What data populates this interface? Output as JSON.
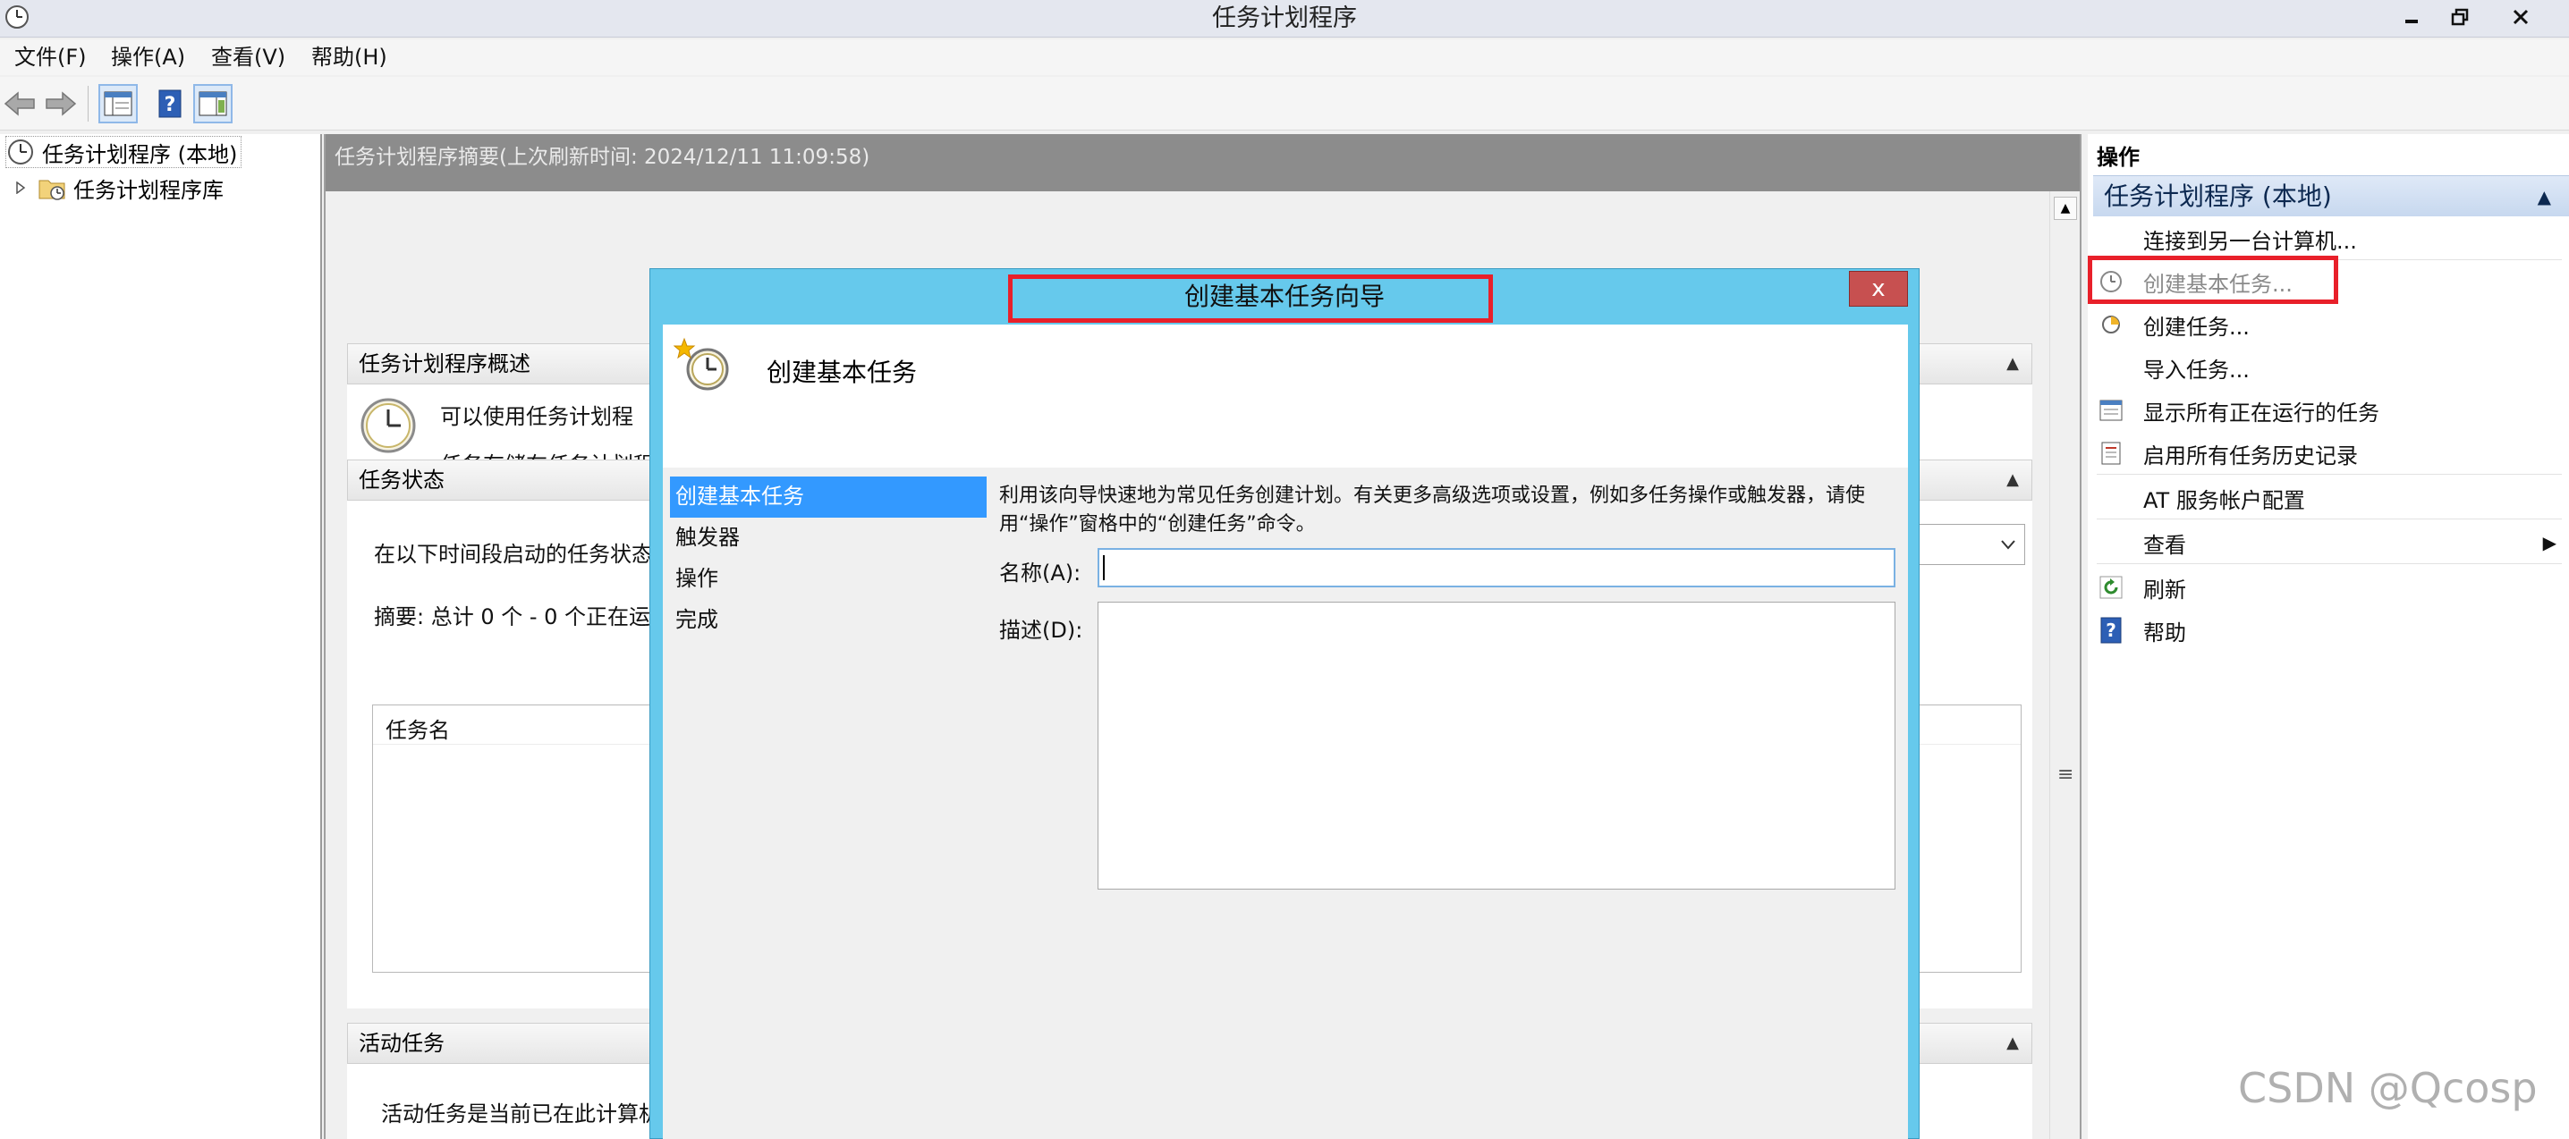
{
  "window": {
    "title": "任务计划程序"
  },
  "menu": [
    "文件(F)",
    "操作(A)",
    "查看(V)",
    "帮助(H)"
  ],
  "tree": {
    "root": "任务计划程序 (本地)",
    "child": "任务计划程序库"
  },
  "center": {
    "summary_header": "任务计划程序摘要(上次刷新时间: 2024/12/11 11:09:58)",
    "overview": {
      "title": "任务计划程序概述",
      "line1": "可以使用任务计划程",
      "line2": "任务存储在任务计划程"
    },
    "status": {
      "title": "任务状态",
      "period_label": "在以下时间段启动的任务状态",
      "summary": "摘要: 总计 0 个 - 0 个正在运",
      "column_task_name": "任务名"
    },
    "active": {
      "title": "活动任务",
      "text": "活动任务是当前已在此计算机"
    }
  },
  "actions": {
    "title": "操作",
    "group": "任务计划程序 (本地)",
    "items": [
      {
        "label": "连接到另一台计算机...",
        "icon": "none"
      },
      {
        "label": "创建基本任务...",
        "icon": "wizard-clock-icon",
        "disabled": true
      },
      {
        "label": "创建任务...",
        "icon": "create-task-icon"
      },
      {
        "label": "导入任务...",
        "icon": "none"
      },
      {
        "label": "显示所有正在运行的任务",
        "icon": "running-tasks-icon"
      },
      {
        "label": "启用所有任务历史记录",
        "icon": "history-icon"
      },
      {
        "label": "AT 服务帐户配置",
        "icon": "none"
      },
      {
        "label": "查看",
        "icon": "none",
        "submenu": true
      },
      {
        "label": "刷新",
        "icon": "refresh-icon"
      },
      {
        "label": "帮助",
        "icon": "help-icon"
      }
    ]
  },
  "dialog": {
    "title": "创建基本任务向导",
    "close": "x",
    "header": "创建基本任务",
    "steps": [
      "创建基本任务",
      "触发器",
      "操作",
      "完成"
    ],
    "description": "利用该向导快速地为常见任务创建计划。有关更多高级选项或设置，例如多任务操作或触发器，请使用“操作”窗格中的“创建任务”命令。",
    "name_label": "名称(A):",
    "name_value": "",
    "desc_label": "描述(D):",
    "desc_value": ""
  },
  "watermark": "CSDN @Qcosp",
  "colors": {
    "dialog_frame": "#66c9ec",
    "highlight": "#e8202a",
    "step_active": "#3399ff",
    "summary_header": "#8c8c8c"
  }
}
